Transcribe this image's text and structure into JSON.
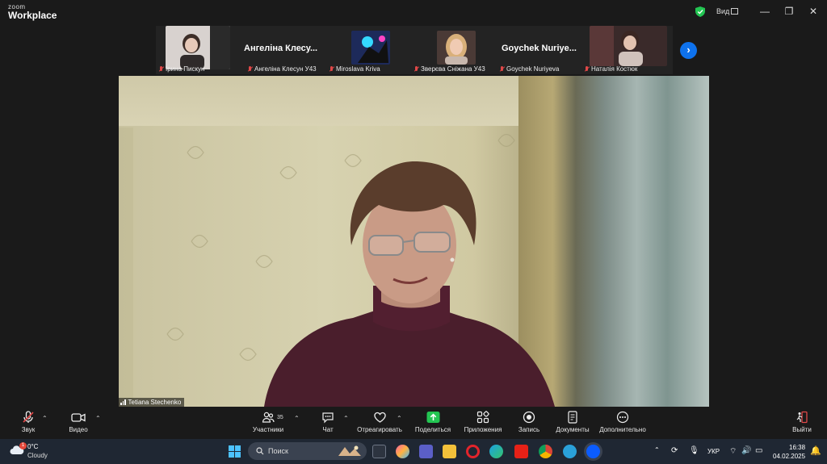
{
  "app": {
    "brand_top": "zoom",
    "brand_bottom": "Workplace",
    "view_label": "Вид"
  },
  "participants": [
    {
      "name": "Ірина Пискун",
      "video": true
    },
    {
      "name": "Ангеліна Клесун У43",
      "display": "Ангеліна  Клесу...",
      "video": false
    },
    {
      "name": "Miroslava Kriva",
      "video": true
    },
    {
      "name": "Зверєва Сніжана У43",
      "video": true
    },
    {
      "name": "Goychek Nuriyeva",
      "display": "Goychek  Nuriye...",
      "video": false
    },
    {
      "name": "Наталія Костюк",
      "video": true
    }
  ],
  "main_video": {
    "speaker_name": "Tetiana Stechenko"
  },
  "toolbar": {
    "audio": "Звук",
    "video": "Видео",
    "participants": "Участники",
    "participants_count": "35",
    "chat": "Чат",
    "react": "Отреагировать",
    "share": "Поделиться",
    "apps": "Приложения",
    "record": "Запись",
    "docs": "Документы",
    "more": "Дополнительно",
    "leave": "Выйти"
  },
  "taskbar": {
    "temperature": "0°C",
    "condition": "Cloudy",
    "weather_badge": "1",
    "search_placeholder": "Поиск",
    "language": "УКР",
    "time": "16:38",
    "date": "04.02.2025"
  },
  "colors": {
    "accent_blue": "#0e72ed",
    "share_green": "#23c552",
    "mute_red": "#e04848"
  }
}
